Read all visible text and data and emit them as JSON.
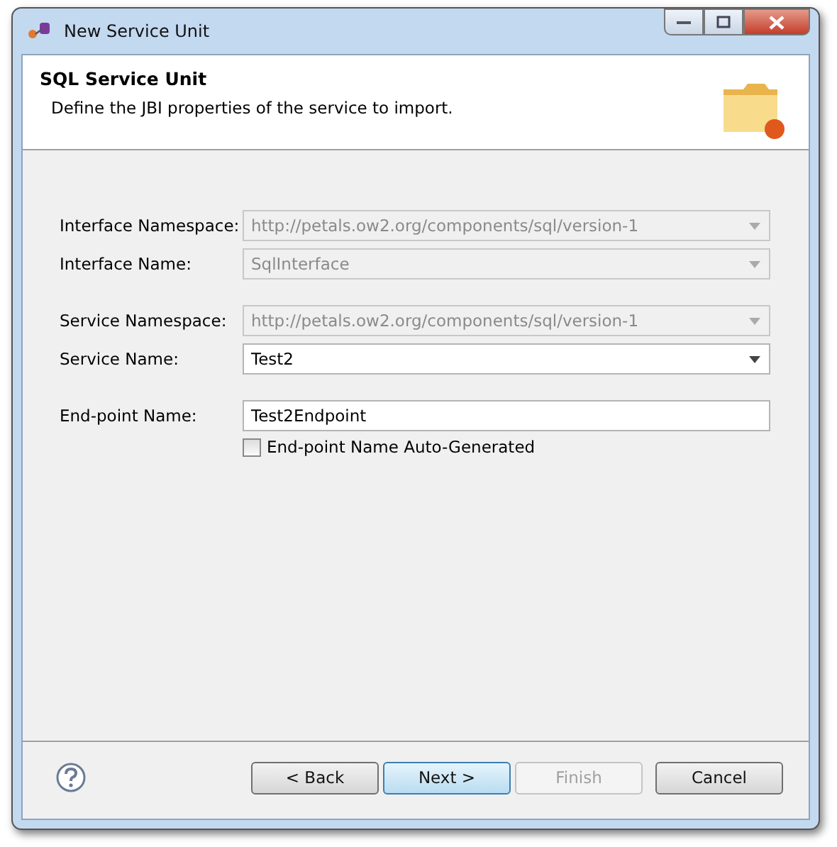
{
  "window": {
    "title": "New Service Unit"
  },
  "header": {
    "title": "SQL Service Unit",
    "description": "Define the JBI properties of the service to import."
  },
  "field_groups": [
    {
      "fields": [
        {
          "label": "Interface Namespace:",
          "kind": "combo",
          "value": "http://petals.ow2.org/components/sql/version-1",
          "disabled": true
        },
        {
          "label": "Interface Name:",
          "kind": "combo",
          "value": "SqlInterface",
          "disabled": true
        }
      ]
    },
    {
      "fields": [
        {
          "label": "Service Namespace:",
          "kind": "combo",
          "value": "http://petals.ow2.org/components/sql/version-1",
          "disabled": true
        },
        {
          "label": "Service Name:",
          "kind": "combo",
          "value": "Test2",
          "disabled": false
        }
      ]
    },
    {
      "fields": [
        {
          "label": "End-point Name:",
          "kind": "text",
          "value": "Test2Endpoint",
          "disabled": false
        }
      ]
    }
  ],
  "checkbox": {
    "label": "End-point Name Auto-Generated",
    "checked": false
  },
  "buttons": [
    {
      "label": "< Back",
      "disabled": false,
      "default": false
    },
    {
      "label": "Next >",
      "disabled": false,
      "default": true
    },
    {
      "label": "Finish",
      "disabled": true,
      "default": false
    },
    {
      "label": "Cancel",
      "disabled": false,
      "default": false
    }
  ]
}
